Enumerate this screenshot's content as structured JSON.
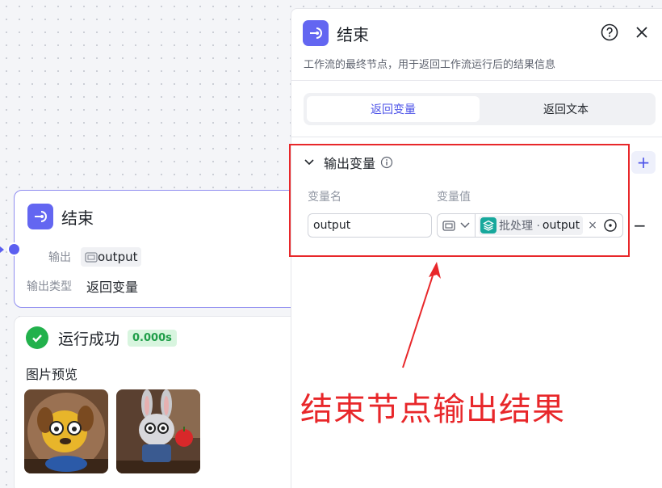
{
  "node": {
    "title": "结束",
    "output_label": "输出",
    "output_value": "output",
    "type_label": "输出类型",
    "type_value": "返回变量"
  },
  "run": {
    "title": "运行成功",
    "time": "0.000s",
    "preview_label": "图片预览"
  },
  "panel": {
    "title": "结束",
    "description": "工作流的最终节点，用于返回工作流运行后的结果信息",
    "tabs": [
      {
        "label": "返回变量",
        "active": true
      },
      {
        "label": "返回文本",
        "active": false
      }
    ],
    "section_title": "输出变量",
    "col_name": "变量名",
    "col_value": "变量值",
    "var_name": "output",
    "var_ref_prefix": "批处理 ·",
    "var_ref_name": "output"
  },
  "annotation": {
    "text": "结束节点输出结果",
    "color": "#e8272a"
  },
  "colors": {
    "accent": "#6366f1",
    "success": "#22b14c",
    "batch": "#17a89c"
  }
}
